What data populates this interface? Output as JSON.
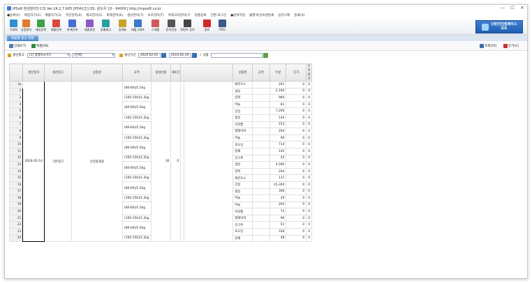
{
  "window": {
    "title": "iPSoft 판넨관리3 C/S  Ver.24.2.7.605  [PDA1인] OS: 윈도우 10 - 64비트]  http://mpsoft.co.kr",
    "min": "—",
    "max": "☐",
    "close": "✕"
  },
  "menu": [
    "●등록(1)",
    "매입하기(2)",
    "매출하기(3)",
    "주문관리(4)",
    "재고관리(5)",
    "회계관리(6)",
    "생산관리(7)",
    "보조관리(T)",
    "카테고리관리(7)",
    "정품등록",
    "간편 로그인",
    "●원격지원",
    "불편개선/의견등록",
    "응지구매",
    "종료(X)"
  ],
  "toolbar": [
    {
      "label": "거래처",
      "color": "#2f8fd0",
      "icon": "client-icon"
    },
    {
      "label": "상품관리",
      "color": "#e07a2e",
      "icon": "product-icon"
    },
    {
      "label": "매입등록",
      "color": "#3aa04a",
      "icon": "purchase-icon"
    },
    {
      "label": "매출등록",
      "color": "#d84a3a",
      "icon": "sales-icon"
    },
    {
      "label": "회계등록",
      "color": "#4a6fd0",
      "icon": "accounting-icon"
    },
    {
      "label": "매출원장",
      "color": "#8a5cc8",
      "icon": "ledger-icon"
    },
    {
      "label": "일별재고",
      "color": "#2aa0a0",
      "icon": "stock-icon"
    },
    {
      "label": "일계표",
      "color": "#c8a12a",
      "icon": "daily-icon"
    },
    {
      "label": "매출그래프",
      "color": "#3a78c8",
      "icon": "chart-icon"
    },
    {
      "label": "스케줄",
      "color": "#d05a5a",
      "icon": "calendar-icon"
    },
    {
      "label": "문자전송",
      "color": "#555555",
      "icon": "sms-icon"
    },
    {
      "label": "화면보 강의",
      "color": "#444444",
      "icon": "lecture-icon"
    },
    {
      "label": "종료",
      "color": "#d02828",
      "icon": "power-icon"
    },
    {
      "label": "POS",
      "color": "#3a5a8a",
      "icon": "pos-icon"
    }
  ],
  "brand": {
    "line1": "[세인인]컴제이스",
    "line2": "프트"
  },
  "tab_label": "제품별 생산 현황",
  "subtool": {
    "print": "인쇄(F7)",
    "excel": "엑셀(F8)",
    "search": "조회(F5)",
    "close": "닫기(C)"
  },
  "filter": {
    "warehouse_label": "생산창고",
    "warehouse_value": "[1] 엠제이소프트",
    "type_value": "[전체]",
    "period_label": "생산기간",
    "date_from": "2024-02-01",
    "date_to": "2024-02-29",
    "product_label": "상품",
    "product_value": ""
  },
  "columns": [
    "생산일자",
    "생산창고",
    "상품명",
    "규격",
    "실생산량",
    "재조단",
    "",
    "상품명",
    "규격",
    "수량",
    "단가",
    "단위원가"
  ],
  "merged": {
    "date": "2024-02-14",
    "warehouse": "기본창고",
    "product": "간장돌게장",
    "produced": "30",
    "unit": "0"
  },
  "spec_left": [
    "(80-60)/2.5kg",
    "(100-150)/1.2kg",
    "(80-60)/2.5kg",
    "(100-150)/1.2kg",
    "(80-60)/2.5kg",
    "(100-150)/1.2kg",
    "(80-60)/2.5kg",
    "(100-150)/1.2kg",
    "(80-60)/2.5kg",
    "(100-150)/1.2kg",
    "(80-60)/2.5kg",
    "(100-150)/1.2kg",
    "(80-60)/2.5kg",
    "(100-150)/1.2kg",
    "(80-60)/2.5kg",
    "(100-150)/1.2kg"
  ],
  "rows": [
    {
      "name": "레몬즈스",
      "qty": "291",
      "price": "0",
      "unit": "0"
    },
    {
      "name": "설탕",
      "qty": "2,160",
      "price": "0",
      "unit": "0"
    },
    {
      "name": "양파",
      "qty": "960",
      "price": "0",
      "unit": "0"
    },
    {
      "name": "마늘",
      "qty": "81",
      "price": "0",
      "unit": "0"
    },
    {
      "name": "간장",
      "qty": "7,200",
      "price": "0",
      "unit": "0"
    },
    {
      "name": "생강",
      "qty": "144",
      "price": "0",
      "unit": "0"
    },
    {
      "name": "카라멜",
      "qty": "153",
      "price": "0",
      "unit": "0"
    },
    {
      "name": "엘레이저",
      "qty": "204",
      "price": "0",
      "unit": "0"
    },
    {
      "name": "미늘",
      "qty": "96",
      "price": "0",
      "unit": "0"
    },
    {
      "name": "포도당",
      "qty": "714",
      "price": "0",
      "unit": "0"
    },
    {
      "name": "감재",
      "qty": "102",
      "price": "0",
      "unit": "0"
    },
    {
      "name": "건고추",
      "qty": "24",
      "price": "0",
      "unit": "0"
    },
    {
      "name": "설탕",
      "qty": "4,590",
      "price": "0",
      "unit": "0"
    },
    {
      "name": "양파",
      "qty": "204",
      "price": "0",
      "unit": "0"
    },
    {
      "name": "레몬즈스",
      "qty": "137",
      "price": "0",
      "unit": "0"
    },
    {
      "name": "간장",
      "qty": "15,300",
      "price": "0",
      "unit": "0"
    },
    {
      "name": "생강",
      "qty": "306",
      "price": "0",
      "unit": "0"
    },
    {
      "name": "마늘",
      "qty": "29",
      "price": "0",
      "unit": "0"
    },
    {
      "name": "미늘",
      "qty": "204",
      "price": "0",
      "unit": "0"
    },
    {
      "name": "카라멜",
      "qty": "72",
      "price": "0",
      "unit": "0"
    },
    {
      "name": "엘레이저",
      "qty": "96",
      "price": "0",
      "unit": "0"
    },
    {
      "name": "건고추",
      "qty": "51",
      "price": "0",
      "unit": "0"
    },
    {
      "name": "포도당",
      "qty": "336",
      "price": "0",
      "unit": "0"
    },
    {
      "name": "감재",
      "qty": "48",
      "price": "0",
      "unit": "0"
    }
  ]
}
